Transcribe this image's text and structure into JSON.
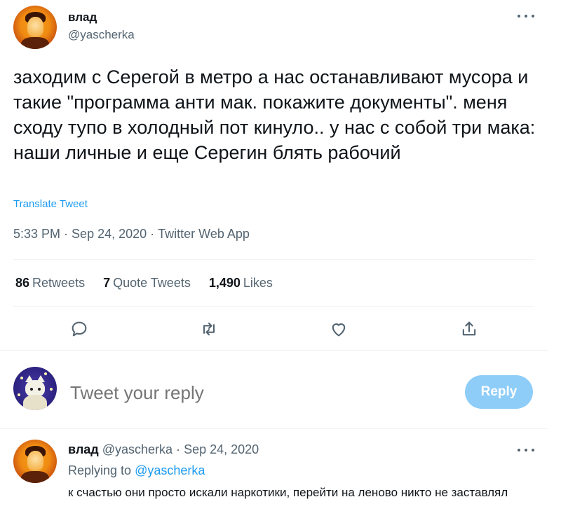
{
  "tweet": {
    "author_name": "влад",
    "author_handle": "@yascherka",
    "more_icon": "more-horizontal-icon",
    "text": "заходим с Серегой в метро а нас останавливают мусора и такие \"программа анти мак. покажите документы\". меня сходу тупо в холодный пот кинуло.. у нас с собой три мака: наши личные и еще Серегин блять рабочий",
    "translate_label": "Translate Tweet",
    "time": "5:33 PM",
    "date": "Sep 24, 2020",
    "source": "Twitter Web App",
    "separator": "·"
  },
  "stats": {
    "retweets_count": "86",
    "retweets_label": "Retweets",
    "quotes_count": "7",
    "quotes_label": "Quote Tweets",
    "likes_count": "1,490",
    "likes_label": "Likes"
  },
  "actions": {
    "reply_icon": "reply-icon",
    "retweet_icon": "retweet-icon",
    "like_icon": "heart-icon",
    "share_icon": "share-icon"
  },
  "compose": {
    "placeholder": "Tweet your reply",
    "reply_button": "Reply"
  },
  "reply": {
    "author_name": "влад",
    "author_handle": "@yascherka",
    "separator": "·",
    "date": "Sep 24, 2020",
    "replying_prefix": "Replying to",
    "replying_to": "@yascherka",
    "text": "к счастью они просто искали наркотики, перейти на леново никто не заставлял"
  },
  "colors": {
    "accent": "#1d9bf0",
    "reply_button_disabled": "#8ecdf8",
    "secondary_text": "#536471"
  }
}
